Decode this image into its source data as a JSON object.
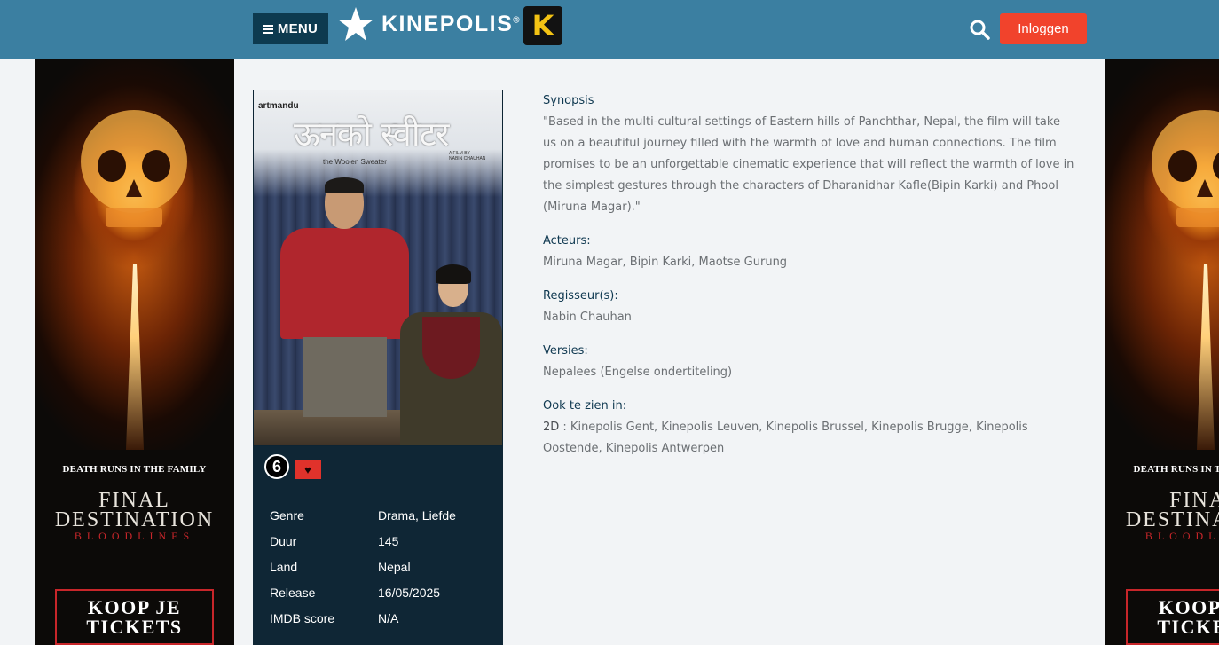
{
  "header": {
    "menu_label": "MENU",
    "logo_text": "KINEPOLIS",
    "logo_reg": "®",
    "badge_letter": "K",
    "login_label": "Inloggen"
  },
  "ad": {
    "tagline": "DEATH RUNS IN THE FAMILY",
    "title_line1": "FINAL",
    "title_line2": "DESTINATION",
    "subtitle": "BLOODLINES",
    "cta_line1": "KOOP JE",
    "cta_line2": "TICKETS"
  },
  "poster": {
    "brand": "artmandu",
    "title": "ऊनको स्वीटर",
    "subtitle": "the Woolen Sweater",
    "credit_line1": "A FILM BY",
    "credit_line2": "NABIN CHAUHAN"
  },
  "badges": {
    "age": "6",
    "heart": "♥"
  },
  "info": [
    {
      "key": "Genre",
      "value": "Drama, Liefde"
    },
    {
      "key": "Duur",
      "value": "145"
    },
    {
      "key": "Land",
      "value": "Nepal"
    },
    {
      "key": "Release",
      "value": "16/05/2025"
    },
    {
      "key": "IMDB score",
      "value": "N/A"
    }
  ],
  "details": {
    "synopsis_h": "Synopsis",
    "synopsis": "\"Based in the multi-cultural settings of Eastern hills of Panchthar, Nepal, the film will take us on a beautiful journey filled with the warmth of love and human connections. The film promises to be an unforgettable cinematic experience that will reflect the warmth of love in the simplest gestures through the characters of Dharanidhar Kafle(Bipin Karki) and Phool (Miruna Magar).\"",
    "actors_h": "Acteurs:",
    "actors": "Miruna Magar, Bipin Karki, Maotse Gurung",
    "director_h": "Regisseur(s):",
    "director": "Nabin Chauhan",
    "versions_h": "Versies:",
    "versions": "Nepalees (Engelse ondertiteling)",
    "showing_h": "Ook te zien in:",
    "showing_format": "2D",
    "showing": " : Kinepolis Gent, Kinepolis Leuven, Kinepolis Brussel, Kinepolis Brugge, Kinepolis Oostende, Kinepolis Antwerpen"
  },
  "colors": {
    "header_bg": "#3b7fa1",
    "menu_bg": "#0d3a4f",
    "login_bg": "#f1432c",
    "panel_bg": "#0f2635",
    "heading": "#0f3850",
    "text": "#6b6f73"
  },
  "icons": {
    "menu": "hamburger-icon",
    "logo": "star-icon",
    "search": "search-icon",
    "heart": "heart-icon"
  }
}
